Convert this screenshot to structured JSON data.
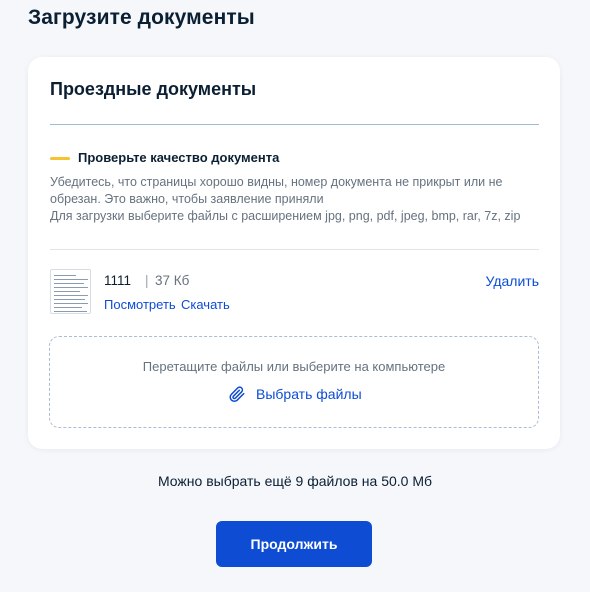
{
  "page": {
    "title": "Загрузите документы"
  },
  "card": {
    "title": "Проездные документы",
    "check_title": "Проверьте качество документа",
    "hint_line1": "Убедитесь, что страницы хорошо видны, номер документа не прикрыт или не обрезан. Это важно, чтобы заявление приняли",
    "hint_line2": "Для загрузки выберите файлы с расширением jpg, png, pdf, jpeg, bmp, rar, 7z, zip"
  },
  "file": {
    "name": "1111",
    "separator": "|",
    "size": "37 Кб",
    "view_label": "Посмотреть",
    "download_label": "Скачать",
    "delete_label": "Удалить",
    "thumb_icon": "document-thumbnail"
  },
  "dropzone": {
    "hint": "Перетащите файлы или выберите на компьютере",
    "choose_label": "Выбрать файлы",
    "icon": "paperclip-icon"
  },
  "limit_text": "Можно выбрать ещё 9 файлов на 50.0 Мб",
  "continue_label": "Продолжить",
  "colors": {
    "accent": "#0d4cd3",
    "warning_line": "#f5c330",
    "text_primary": "#0b1f33",
    "text_secondary": "#66727f"
  }
}
